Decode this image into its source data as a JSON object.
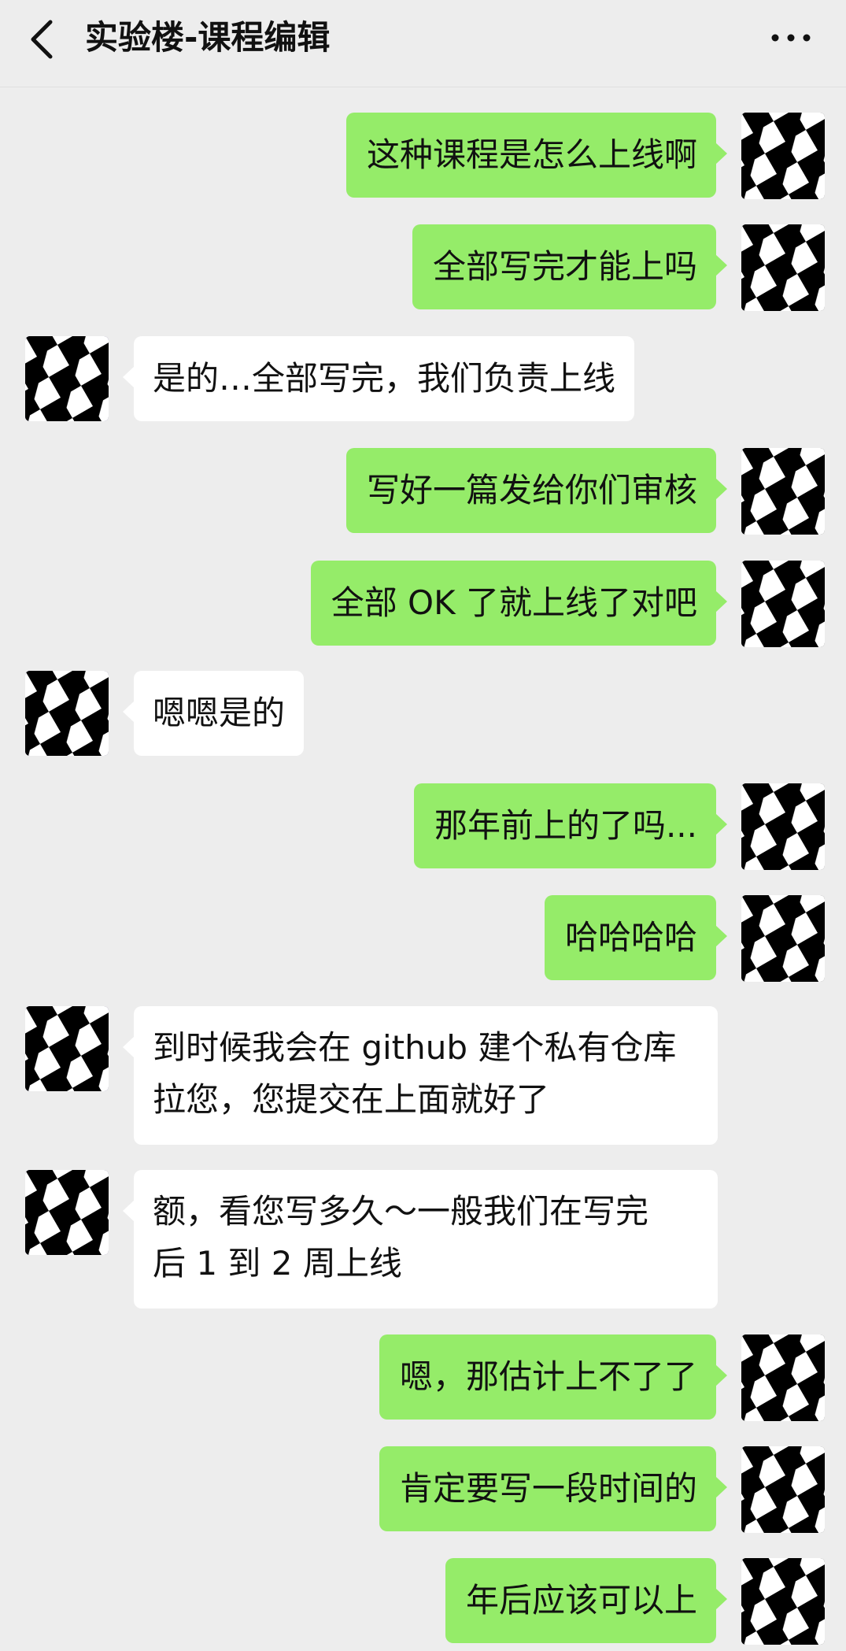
{
  "header": {
    "title": "实验楼-课程编辑",
    "back_icon": "chevron-left-icon",
    "more_icon": "more-dots-icon"
  },
  "colors": {
    "background": "#ededed",
    "my_bubble": "#95ec69",
    "their_bubble": "#ffffff"
  },
  "messages": [
    {
      "sender": "me",
      "text": "这种课程是怎么上线啊"
    },
    {
      "sender": "me",
      "text": "全部写完才能上吗"
    },
    {
      "sender": "other",
      "text": "是的…全部写完，我们负责上线"
    },
    {
      "sender": "me",
      "text": "写好一篇发给你们审核"
    },
    {
      "sender": "me",
      "text": "全部 OK 了就上线了对吧"
    },
    {
      "sender": "other",
      "text": "嗯嗯是的"
    },
    {
      "sender": "me",
      "text": "那年前上的了吗..."
    },
    {
      "sender": "me",
      "text": "哈哈哈哈"
    },
    {
      "sender": "other",
      "lines": [
        "到时候我会在 github 建个私有仓库",
        "拉您，您提交在上面就好了"
      ]
    },
    {
      "sender": "other",
      "lines": [
        "额，看您写多久～一般我们在写完",
        "后 1 到 2 周上线"
      ]
    },
    {
      "sender": "me",
      "text": "嗯，那估计上不了了"
    },
    {
      "sender": "me",
      "text": "肯定要写一段时间的"
    },
    {
      "sender": "me",
      "text": "年后应该可以上"
    }
  ]
}
